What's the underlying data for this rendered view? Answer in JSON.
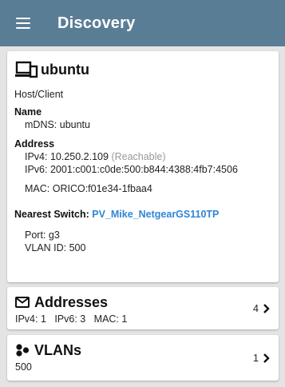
{
  "appbar": {
    "title": "Discovery"
  },
  "device": {
    "name": "ubuntu",
    "type": "Host/Client",
    "name_label": "Name",
    "mdns": "mDNS: ubuntu",
    "address_label": "Address",
    "ipv4": "IPv4: 10.250.2.109",
    "ipv4_status": "(Reachable)",
    "ipv6": "IPv6: 2001:c001:c0de:500:b844:4388:4fb7:4506",
    "mac": "MAC: ORICO:f01e34-1fbaa4",
    "nearest_switch_label": "Nearest Switch:",
    "nearest_switch": "PV_Mike_NetgearGS110TP",
    "port": "Port: g3",
    "vlan_id": "VLAN ID: 500"
  },
  "addresses_card": {
    "title": "Addresses",
    "summary": "IPv4: 1   IPv6: 3   MAC: 1",
    "count": "4",
    "icon": "envelope-icon"
  },
  "vlans_card": {
    "title": "VLANs",
    "summary": "500",
    "count": "1",
    "icon": "vlan-cluster-icon"
  },
  "colors": {
    "appbar": "#5a7d96",
    "link": "#2f86d6",
    "muted": "#999999",
    "background": "#e4e4e4"
  }
}
